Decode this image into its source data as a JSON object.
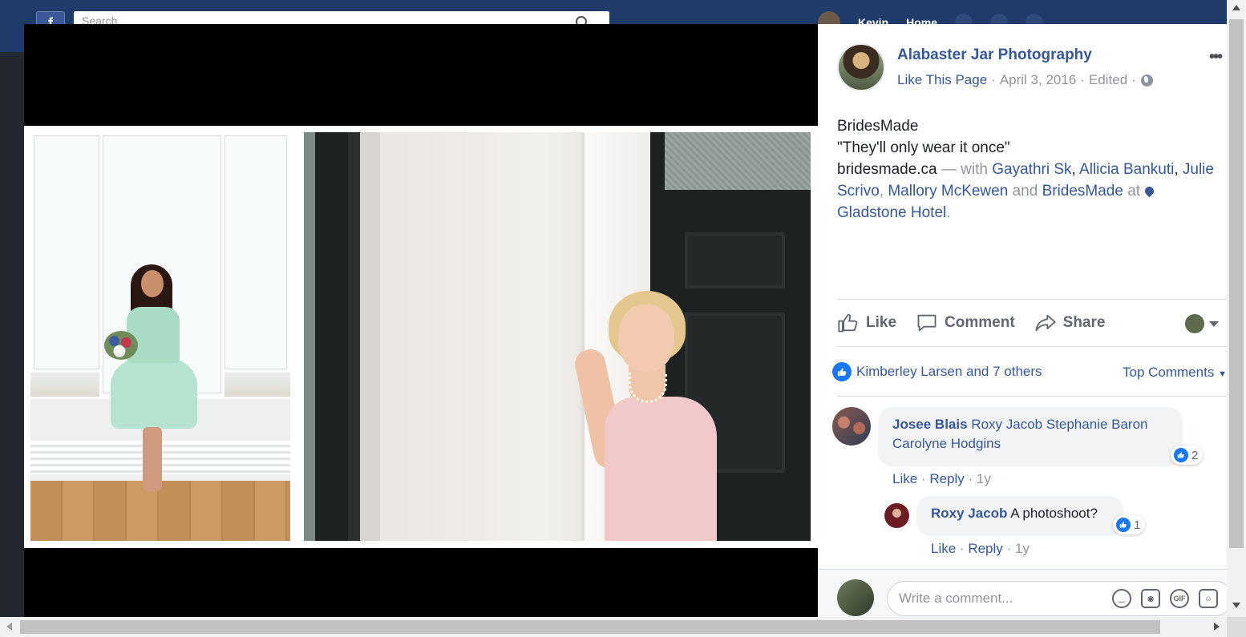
{
  "header": {
    "logo": "f",
    "search_placeholder": "Search",
    "nav_user": "Kevin",
    "nav_home": "Home"
  },
  "post": {
    "page_name": "Alabaster Jar Photography",
    "like_page": "Like This Page",
    "date": "April 3, 2016",
    "edited": "Edited",
    "separator": "·",
    "privacy_icon": "globe-icon",
    "more_label": "•••",
    "text_line1": "BridesMade",
    "text_line2": "\"They'll only wear it once\"",
    "link_text": "bridesmade.ca",
    "with_text": "— with",
    "tagged": [
      "Gayathri Sk",
      "Allicia Bankuti",
      "Julie Scrivo",
      "Mallory McKewen",
      "BridesMade"
    ],
    "and_text": "and",
    "at_text": "at",
    "location": "Gladstone Hotel",
    "period": "."
  },
  "actions": {
    "like": "Like",
    "comment": "Comment",
    "share": "Share"
  },
  "reactions": {
    "summary": "Kimberley Larsen and 7 others",
    "sort": "Top Comments"
  },
  "comments": [
    {
      "author": "Josee Blais",
      "text": "Roxy Jacob Stephanie Baron Carolyne Hodgins",
      "reactions": "2",
      "like": "Like",
      "reply": "Reply",
      "time": "1y"
    },
    {
      "author": "Roxy Jacob",
      "text": "A photoshoot?",
      "reactions": "1",
      "like": "Like",
      "reply": "Reply",
      "time": "1y"
    }
  ],
  "composer": {
    "placeholder": "Write a comment...",
    "icons": [
      "emoji-icon",
      "camera-icon",
      "gif-icon",
      "sticker-icon"
    ],
    "gif_label": "GIF"
  },
  "colors": {
    "link": "#365899",
    "muted": "#90949c",
    "accent": "#1877f2"
  }
}
